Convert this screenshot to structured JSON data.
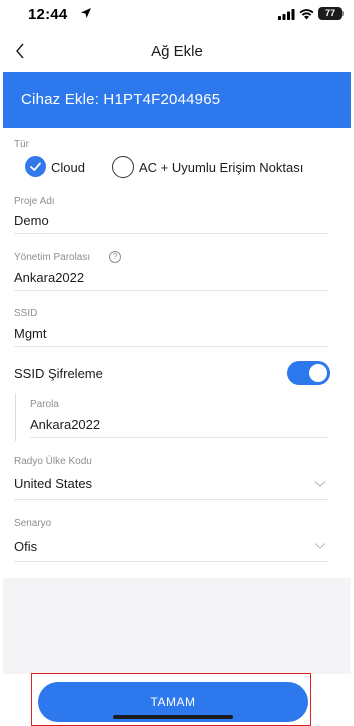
{
  "status_bar": {
    "time": "12:44",
    "battery": "77"
  },
  "nav": {
    "title": "Ağ Ekle",
    "back_icon": "chevron-left-icon"
  },
  "banner": {
    "text": "Cihaz Ekle: H1PT4F2044965"
  },
  "form": {
    "type": {
      "label": "Tür",
      "options": [
        {
          "label": "Cloud",
          "selected": true
        },
        {
          "label": "AC + Uyumlu Erişim Noktası",
          "selected": false
        }
      ]
    },
    "project_name": {
      "label": "Proje Adı",
      "value": "Demo"
    },
    "admin_password": {
      "label": "Yönetim Parolası",
      "value": "Ankara2022"
    },
    "ssid": {
      "label": "SSID",
      "value": "Mgmt"
    },
    "ssid_encryption": {
      "label": "SSID Şifreleme",
      "enabled": true
    },
    "password": {
      "label": "Parola",
      "value": "Ankara2022"
    },
    "country_code": {
      "label": "Radyo Ülke Kodu",
      "value": "United States"
    },
    "scenario": {
      "label": "Senaryo",
      "value": "Ofis"
    }
  },
  "footer": {
    "ok_label": "TAMAM"
  },
  "colors": {
    "accent": "#2e78ee",
    "highlight": "#e02020"
  }
}
